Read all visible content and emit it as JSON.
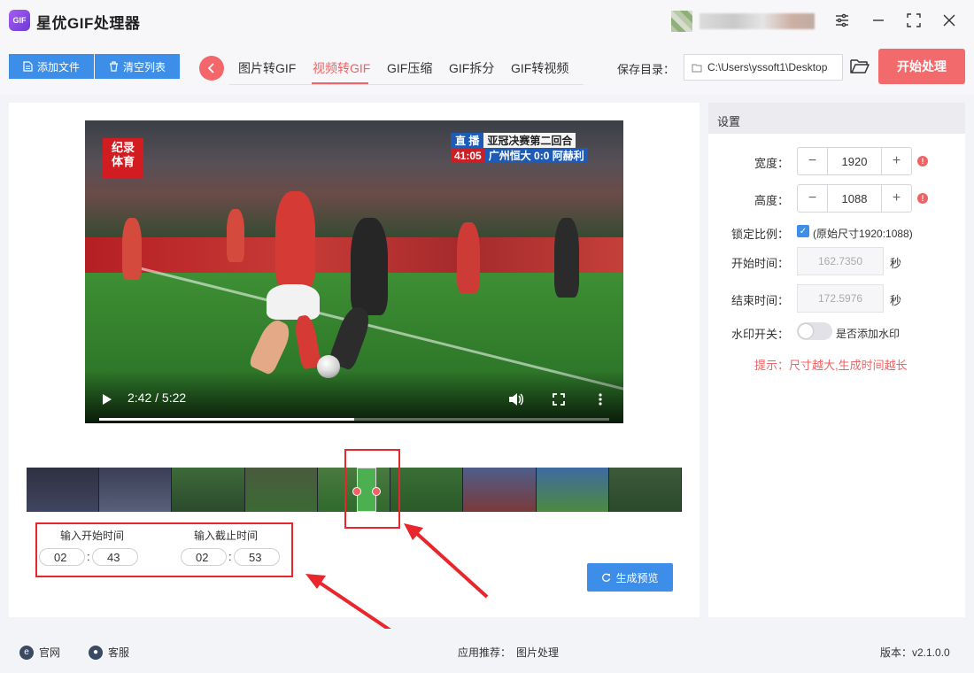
{
  "app": {
    "title": "星优GIF处理器",
    "logo_text": "GIF"
  },
  "window_controls": {
    "settings_icon": "⚌",
    "minimize_icon": "—",
    "maximize_icon": "⛶",
    "close_icon": "✕"
  },
  "toolbar": {
    "add_file_label": "添加文件",
    "clear_list_label": "清空列表",
    "tabs": [
      {
        "label": "图片转GIF",
        "active": false
      },
      {
        "label": "视频转GIF",
        "active": true
      },
      {
        "label": "GIF压缩",
        "active": false
      },
      {
        "label": "GIF拆分",
        "active": false
      },
      {
        "label": "GIF转视频",
        "active": false
      }
    ],
    "save_dir_label": "保存目录：",
    "save_dir_value": "C:\\Users\\yssoft1\\Desktop",
    "start_label": "开始处理"
  },
  "video": {
    "logo_line1": "纪录",
    "logo_line2": "体育",
    "live_tag": "直 播",
    "match_title": "亚冠决赛第二回合",
    "clock": "41:05",
    "score_text": "广州恒大 0:0 阿赫利",
    "time_display": "2:42 / 5:22",
    "progress_fraction": 0.5
  },
  "trim": {
    "start_label": "输入开始时间",
    "start_min": "02",
    "start_sec": "43",
    "end_label": "输入截止时间",
    "end_min": "02",
    "end_sec": "53",
    "preview_label": "生成预览"
  },
  "settings": {
    "header": "设置",
    "width_label": "宽度：",
    "width_value": "1920",
    "height_label": "高度：",
    "height_value": "1088",
    "lock_label": "锁定比例：",
    "lock_checked": true,
    "lock_note": "(原始尺寸1920:1088)",
    "start_time_label": "开始时间：",
    "start_time_value": "162.7350",
    "end_time_label": "结束时间：",
    "end_time_value": "172.5976",
    "seconds_unit": "秒",
    "watermark_label": "水印开关：",
    "watermark_note": "是否添加水印",
    "watermark_on": false,
    "tip": "提示：尺寸越大,生成时间越长"
  },
  "footer": {
    "website_label": "官网",
    "support_label": "客服",
    "recommend_label": "应用推荐：",
    "recommend_app": "图片处理",
    "version": "版本：v2.1.0.0"
  },
  "colors": {
    "accent_red": "#f06264",
    "accent_blue": "#3d8ee8"
  }
}
